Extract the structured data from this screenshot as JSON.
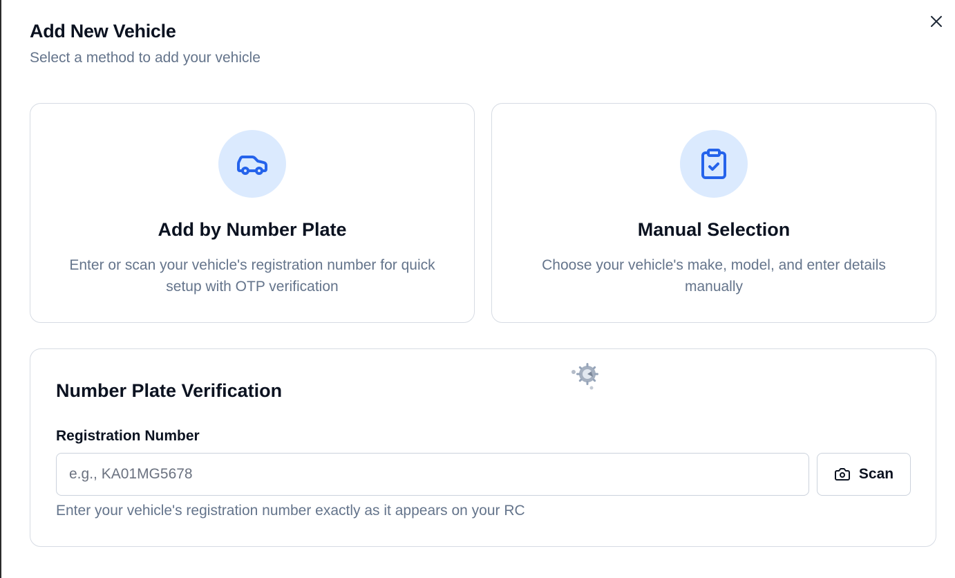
{
  "dialog": {
    "title": "Add New Vehicle",
    "subtitle": "Select a method to add your vehicle",
    "close_icon": "close-icon"
  },
  "methods": [
    {
      "icon": "car-icon",
      "title": "Add by Number Plate",
      "description": "Enter or scan your vehicle's registration number for quick setup with OTP verification"
    },
    {
      "icon": "clipboard-check-icon",
      "title": "Manual Selection",
      "description": "Choose your vehicle's make, model, and enter details manually"
    }
  ],
  "verification": {
    "title": "Number Plate Verification",
    "field_label": "Registration Number",
    "input_value": "",
    "input_placeholder": "e.g., KA01MG5678",
    "scan_label": "Scan",
    "scan_icon": "camera-icon",
    "helper": "Enter your vehicle's registration number exactly as it appears on your RC",
    "loading_icon": "loading-spinner-icon"
  },
  "colors": {
    "accent": "#2563eb",
    "accent_bg": "#dbeafe",
    "muted_text": "#64748b",
    "border": "#d6dbe3"
  }
}
